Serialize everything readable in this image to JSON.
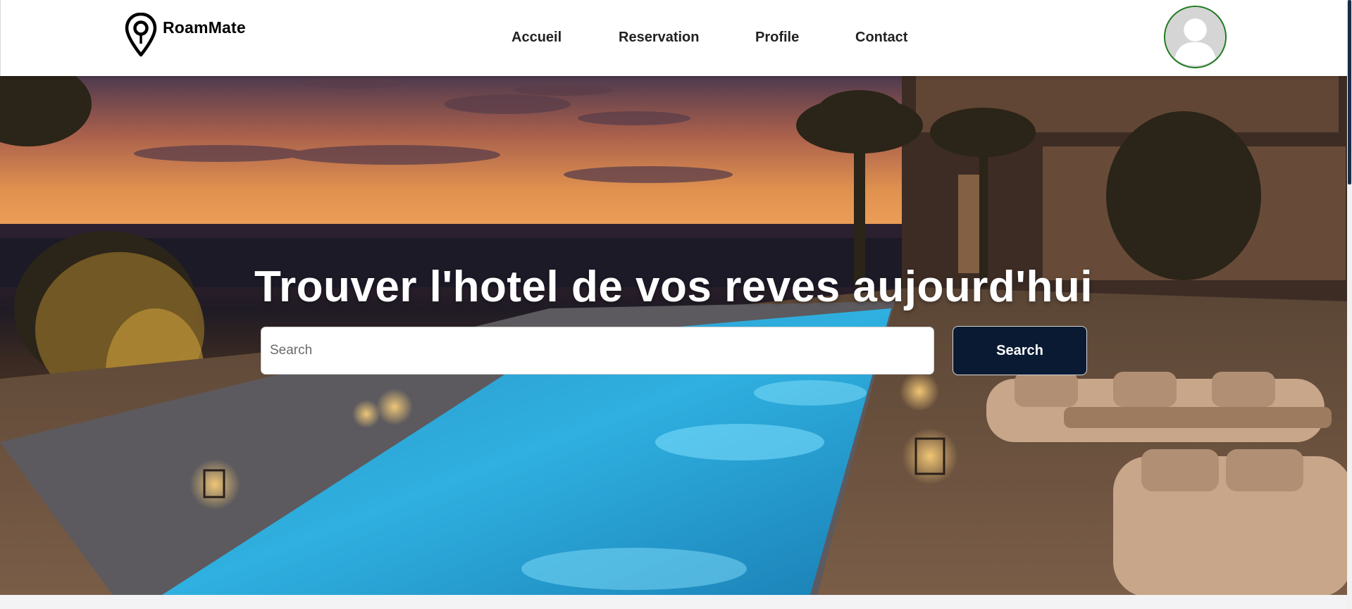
{
  "brand": {
    "name": "RoamMate",
    "logo_icon": "map-pin-icon"
  },
  "nav": {
    "items": [
      {
        "label": "Accueil"
      },
      {
        "label": "Reservation"
      },
      {
        "label": "Profile"
      },
      {
        "label": "Contact"
      }
    ]
  },
  "profile": {
    "avatar_icon": "user-avatar-icon",
    "border_color": "#1e7a1e"
  },
  "hero": {
    "headline": "Trouver l'hotel de vos reves aujourd'hui",
    "search": {
      "placeholder": "Search",
      "value": "",
      "button_label": "Search"
    },
    "background_icon": "hotel-pool-sunset-image"
  },
  "colors": {
    "search_button": "#0a1a33",
    "nav_text": "#222222",
    "hero_text": "#ffffff"
  }
}
